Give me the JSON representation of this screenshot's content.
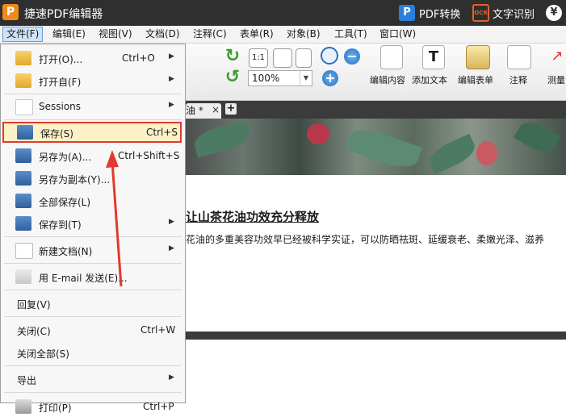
{
  "titlebar": {
    "logo": "P",
    "title": "捷速PDF编辑器",
    "convert_icon": "P",
    "convert_label": "PDF转换",
    "ocr_icon": "OCR",
    "ocr_label": "文字识别",
    "yen_icon": "¥"
  },
  "menubar": {
    "items": [
      "文件(F)",
      "编辑(E)",
      "视图(V)",
      "文档(D)",
      "注释(C)",
      "表单(R)",
      "对象(B)",
      "工具(T)",
      "窗口(W)"
    ]
  },
  "toolbar": {
    "zoom_value": "100%",
    "edit_content_label": "编辑内容",
    "add_text_label": "添加文本",
    "edit_form_label": "编辑表单",
    "annotate_label": "注释",
    "measure_label": "测量",
    "fit_page_label": "1:1"
  },
  "tabs": {
    "doc_tab_label": "油 *",
    "close_glyph": "×",
    "add_glyph": "+"
  },
  "document": {
    "heading": "让山茶花油功效充分释放",
    "body": "花油的多重美容功效早已经被科学实证，可以防晒祛斑、延缓衰老、柔嫩光泽、滋养"
  },
  "file_menu": {
    "items": [
      {
        "label": "打开(O)...",
        "shortcut": "Ctrl+O",
        "submenu": true
      },
      {
        "label": "打开自(F)",
        "shortcut": "",
        "submenu": true
      },
      {
        "label": "Sessions",
        "shortcut": "",
        "submenu": true
      },
      {
        "label": "保存(S)",
        "shortcut": "Ctrl+S",
        "submenu": false
      },
      {
        "label": "另存为(A)...",
        "shortcut": "Ctrl+Shift+S",
        "submenu": false
      },
      {
        "label": "另存为副本(Y)...",
        "shortcut": "",
        "submenu": false
      },
      {
        "label": "全部保存(L)",
        "shortcut": "",
        "submenu": false
      },
      {
        "label": "保存到(T)",
        "shortcut": "",
        "submenu": true
      },
      {
        "label": "新建文档(N)",
        "shortcut": "",
        "submenu": true
      },
      {
        "label": "用 E-mail 发送(E)...",
        "shortcut": "",
        "submenu": false
      },
      {
        "label": "回复(V)",
        "shortcut": "",
        "submenu": false
      },
      {
        "label": "关闭(C)",
        "shortcut": "Ctrl+W",
        "submenu": false
      },
      {
        "label": "关闭全部(S)",
        "shortcut": "",
        "submenu": false
      },
      {
        "label": "导出",
        "shortcut": "",
        "submenu": true
      },
      {
        "label": "打印(P)",
        "shortcut": "Ctrl+P",
        "submenu": false
      }
    ],
    "submenu_glyph": "▶"
  },
  "colors": {
    "titlebar_bg": "#2f2f2f",
    "highlight_border": "#e23a2c",
    "highlight_fill": "#fff1c7",
    "arrow": "#e23a2c"
  }
}
